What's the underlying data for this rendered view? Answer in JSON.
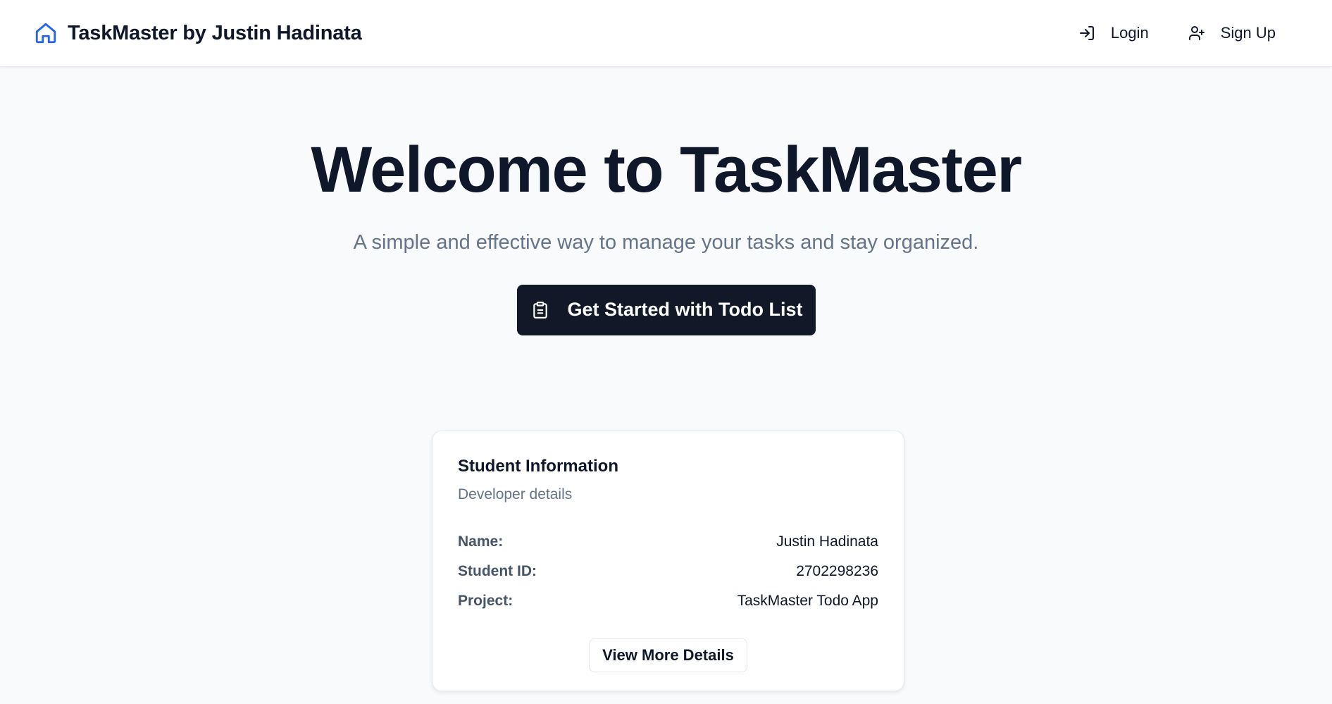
{
  "nav": {
    "brand_title": "TaskMaster by Justin Hadinata",
    "brand_icon": "home-icon",
    "login_label": "Login",
    "login_icon": "log-in-icon",
    "signup_label": "Sign Up",
    "signup_icon": "user-plus-icon"
  },
  "hero": {
    "title": "Welcome to TaskMaster",
    "subtitle": "A simple and effective way to manage your tasks and stay organized.",
    "cta_label": "Get Started with Todo List",
    "cta_icon": "clipboard-icon"
  },
  "student_card": {
    "title": "Student Information",
    "description": "Developer details",
    "rows": [
      {
        "label": "Name:",
        "value": "Justin Hadinata"
      },
      {
        "label": "Student ID:",
        "value": "2702298236"
      },
      {
        "label": "Project:",
        "value": "TaskMaster Todo App"
      }
    ],
    "button_label": "View More Details"
  },
  "colors": {
    "brand_icon": "#2563eb",
    "primary_button": "#111827",
    "background": "#f8fafc",
    "muted_text": "#64748b"
  }
}
